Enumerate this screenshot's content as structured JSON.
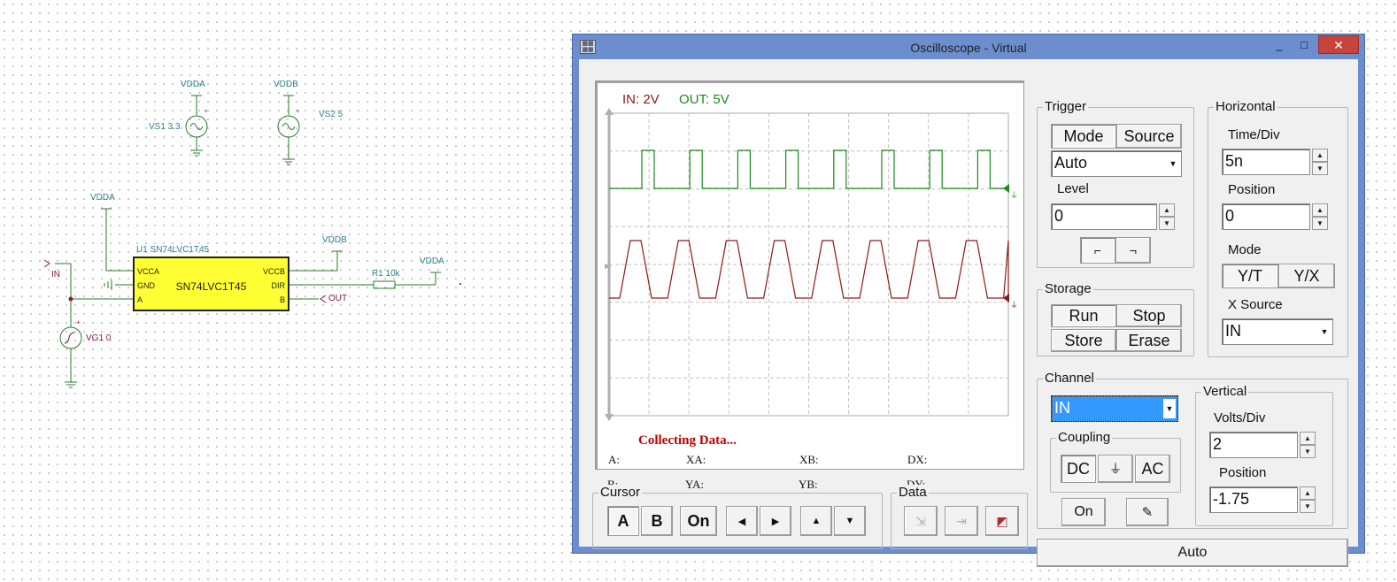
{
  "schematic": {
    "vs1": {
      "net": "VDDA",
      "label": "VS1 3.3",
      "polarity": "+"
    },
    "vs2": {
      "net": "VDDB",
      "label": "VS2 5",
      "polarity": "+"
    },
    "vdda_top": "VDDA",
    "vddb_right": "VDDB",
    "vdda_right": "VDDA",
    "ic": {
      "ref": "U1 SN74LVC1T45",
      "name": "SN74LVC1T45",
      "pins_left": [
        "VCCA",
        "GND",
        "A"
      ],
      "pins_right": [
        "VCCB",
        "DIR",
        "B"
      ]
    },
    "in_label": "IN",
    "out_label": "OUT",
    "resistor": "R1 10k",
    "generator": {
      "label": "VG1 0",
      "polarity": "+"
    }
  },
  "window": {
    "title": "Oscilloscope - Virtual",
    "minimize": "_",
    "maximize": "□",
    "close": "✕"
  },
  "scope": {
    "legend_in": "IN: 2V",
    "legend_out": "OUT: 5V",
    "status": "Collecting Data...",
    "readouts": [
      "A:",
      "XA:",
      "XB:",
      "DX:",
      "B:",
      "YA:",
      "YB:",
      "DY:"
    ],
    "colors": {
      "in": "#8b1a1a",
      "out": "#1a8a1a",
      "grid": "#c0c0c0",
      "status": "#c00000"
    }
  },
  "trigger": {
    "label": "Trigger",
    "mode_button": "Mode",
    "source_button": "Source",
    "mode_value": "Auto",
    "level_label": "Level",
    "level_value": "0",
    "rising_icon": "rising-edge-icon",
    "falling_icon": "falling-edge-icon"
  },
  "horizontal": {
    "label": "Horizontal",
    "time_div_label": "Time/Div",
    "time_div_value": "5n",
    "position_label": "Position",
    "position_value": "0",
    "mode_label": "Mode",
    "yt": "Y/T",
    "yx": "Y/X",
    "xsource_label": "X Source",
    "xsource_value": "IN"
  },
  "storage": {
    "label": "Storage",
    "run": "Run",
    "stop": "Stop",
    "store": "Store",
    "erase": "Erase"
  },
  "channel": {
    "label": "Channel",
    "value": "IN",
    "coupling_label": "Coupling",
    "dc": "DC",
    "gnd": "⏚",
    "ac": "AC",
    "on": "On",
    "probe_icon": "probe-icon"
  },
  "vertical": {
    "label": "Vertical",
    "volts_div_label": "Volts/Div",
    "volts_div_value": "2",
    "position_label": "Position",
    "position_value": "-1.75"
  },
  "cursor": {
    "label": "Cursor",
    "a": "A",
    "b": "B",
    "on": "On"
  },
  "data": {
    "label": "Data"
  },
  "auto_button": "Auto"
}
